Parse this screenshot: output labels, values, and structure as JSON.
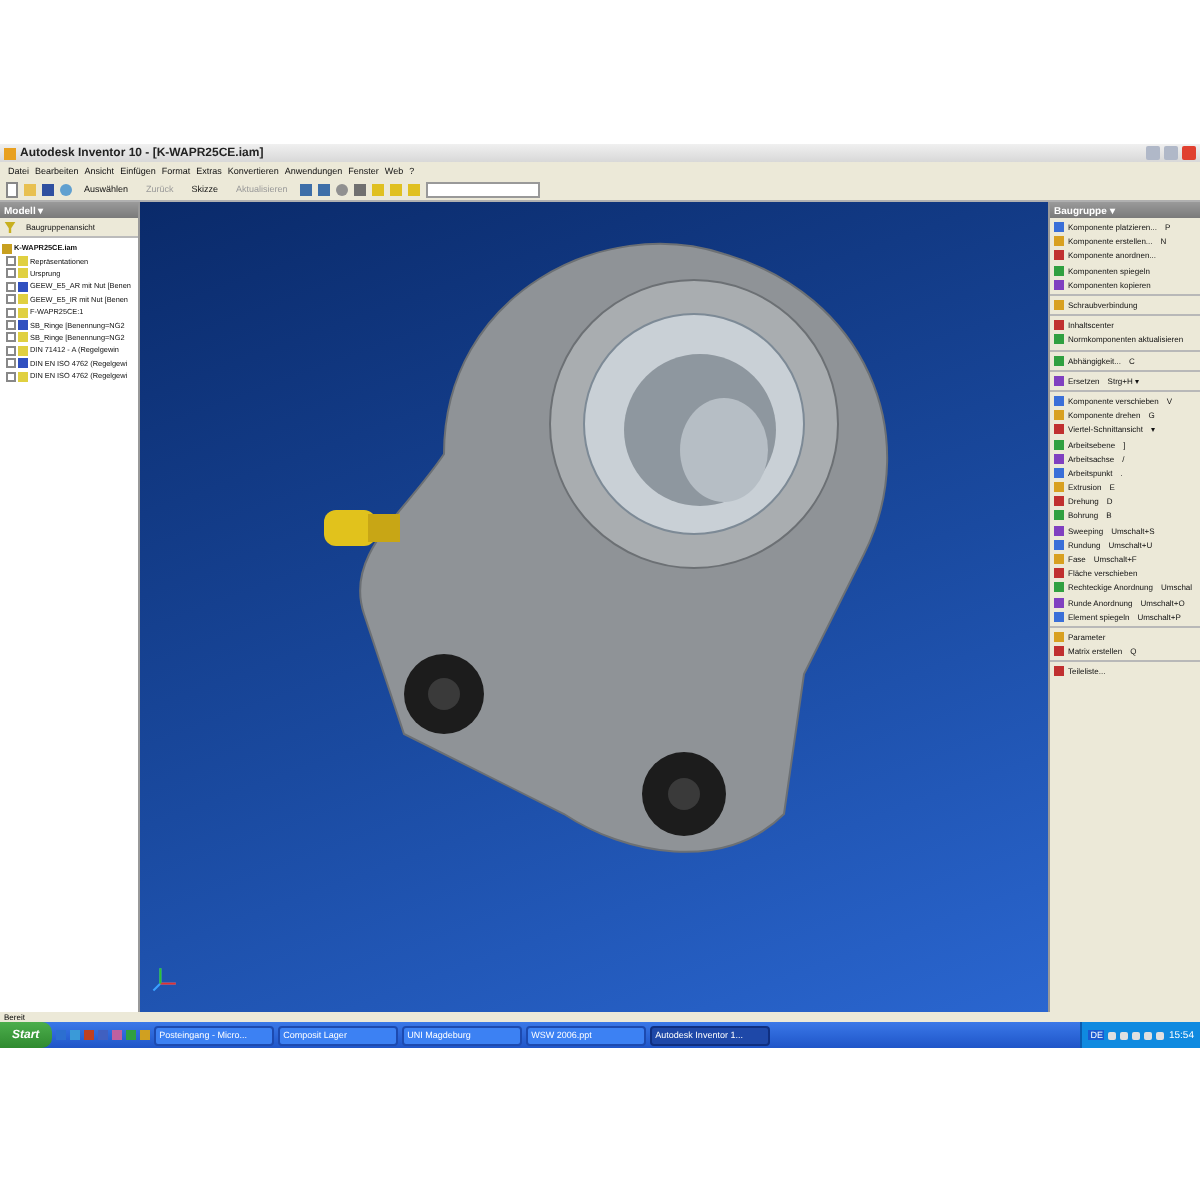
{
  "window": {
    "title": "Autodesk Inventor 10 - [K-WAPR25CE.iam]"
  },
  "menu": [
    "Datei",
    "Bearbeiten",
    "Ansicht",
    "Einfügen",
    "Format",
    "Extras",
    "Konvertieren",
    "Anwendungen",
    "Fenster",
    "Web",
    "?"
  ],
  "toolbar": {
    "select": "Auswählen",
    "back": "Zurück",
    "sketch": "Skizze",
    "update": "Aktualisieren"
  },
  "model_panel": {
    "title": "Modell ▾",
    "view": "Baugruppenansicht",
    "tree": {
      "label": "K-WAPR25CE.iam",
      "children": [
        {
          "label": "Repräsentationen",
          "expanded": false
        },
        {
          "label": "Ursprung",
          "expanded": false
        },
        {
          "label": "GEEW_E5_AR mit Nut [Benen",
          "expanded": false
        },
        {
          "label": "GEEW_E5_IR mit Nut [Benen",
          "expanded": false
        },
        {
          "label": "F-WAPR25CE:1",
          "expanded": false
        },
        {
          "label": "SB_Ringe [Benennung=NG2",
          "expanded": false
        },
        {
          "label": "SB_Ringe [Benennung=NG2",
          "expanded": false
        },
        {
          "label": "DIN 71412 - A (Regelgewin",
          "expanded": false
        },
        {
          "label": "DIN EN ISO 4762 (Regelgewi",
          "expanded": false
        },
        {
          "label": "DIN EN ISO 4762 (Regelgewi",
          "expanded": false
        }
      ]
    }
  },
  "tool_panel": {
    "title": "Baugruppe ▾",
    "groups": [
      [
        {
          "label": "Komponente platzieren...",
          "shortcut": "P"
        },
        {
          "label": "Komponente erstellen...",
          "shortcut": "N"
        },
        {
          "label": "Komponente anordnen..."
        },
        {
          "label": "Komponenten spiegeln"
        },
        {
          "label": "Komponenten kopieren"
        }
      ],
      [
        {
          "label": "Schraubverbindung"
        }
      ],
      [
        {
          "label": "Inhaltscenter"
        },
        {
          "label": "Normkomponenten aktualisieren"
        }
      ],
      [
        {
          "label": "Abhängigkeit...",
          "shortcut": "C"
        }
      ],
      [
        {
          "label": "Ersetzen",
          "shortcut": "Strg+H ▾"
        }
      ],
      [
        {
          "label": "Komponente verschieben",
          "shortcut": "V"
        },
        {
          "label": "Komponente drehen",
          "shortcut": "G"
        },
        {
          "label": "Viertel-Schnittansicht",
          "shortcut": "▾"
        },
        {
          "label": "Arbeitsebene",
          "shortcut": "]"
        },
        {
          "label": "Arbeitsachse",
          "shortcut": "/"
        },
        {
          "label": "Arbeitspunkt",
          "shortcut": "."
        },
        {
          "label": "Extrusion",
          "shortcut": "E"
        },
        {
          "label": "Drehung",
          "shortcut": "D"
        },
        {
          "label": "Bohrung",
          "shortcut": "B"
        },
        {
          "label": "Sweeping",
          "shortcut": "Umschalt+S"
        },
        {
          "label": "Rundung",
          "shortcut": "Umschalt+U"
        },
        {
          "label": "Fase",
          "shortcut": "Umschalt+F"
        },
        {
          "label": "Fläche verschieben"
        },
        {
          "label": "Rechteckige Anordnung",
          "shortcut": "Umschal"
        },
        {
          "label": "Runde Anordnung",
          "shortcut": "Umschalt+O"
        },
        {
          "label": "Element spiegeln",
          "shortcut": "Umschalt+P"
        }
      ],
      [
        {
          "label": "Parameter"
        },
        {
          "label": "Matrix erstellen",
          "shortcut": "Q"
        }
      ],
      [
        {
          "label": "Teileliste..."
        }
      ]
    ]
  },
  "status_bar": "Bereit",
  "taskbar": {
    "start": "Start",
    "tasks": [
      {
        "label": "Posteingang - Micro...",
        "selected": false
      },
      {
        "label": "Composit Lager",
        "selected": false
      },
      {
        "label": "UNI Magdeburg",
        "selected": false
      },
      {
        "label": "WSW 2006.ppt",
        "selected": false
      },
      {
        "label": "Autodesk Inventor 1...",
        "selected": true
      }
    ],
    "language": "DE",
    "clock": "15:54"
  }
}
